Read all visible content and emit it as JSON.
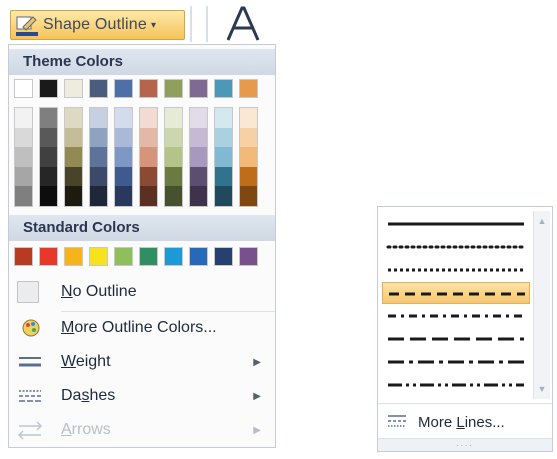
{
  "ribbon": {
    "shape_outline_label": "Shape Outline",
    "dropdown_arrow": "▾",
    "text_icon_char": "A"
  },
  "menu": {
    "theme_colors_label": "Theme Colors",
    "standard_colors_label": "Standard Colors",
    "theme_base": [
      "#ffffff",
      "#1a1a1a",
      "#eeece1",
      "#4a5d7e",
      "#4f6fa8",
      "#b5654b",
      "#8fa05c",
      "#7e6a92",
      "#4b98b8",
      "#e89a4a"
    ],
    "theme_shades": [
      [
        "#f2f2f2",
        "#d9d9d9",
        "#bfbfbf",
        "#a6a6a6",
        "#7f7f7f"
      ],
      [
        "#7f7f7f",
        "#595959",
        "#404040",
        "#262626",
        "#0d0d0d"
      ],
      [
        "#ddd9c3",
        "#c4bd97",
        "#938953",
        "#494429",
        "#1d1b10"
      ],
      [
        "#c6d0e0",
        "#8fa2c2",
        "#5d7399",
        "#3a4a68",
        "#1f2838"
      ],
      [
        "#d3dcec",
        "#a8bad8",
        "#7e97c4",
        "#3e5a8e",
        "#29395e"
      ],
      [
        "#f1dbd2",
        "#e4b8a6",
        "#d6957a",
        "#8b4a34",
        "#5b3023"
      ],
      [
        "#e6ebd7",
        "#ccd7b0",
        "#b3c38a",
        "#6b7943",
        "#48512d"
      ],
      [
        "#e2dcea",
        "#c5b9d4",
        "#a897be",
        "#5d4d70",
        "#3e334a"
      ],
      [
        "#d5e8f0",
        "#abd1e1",
        "#81b9d2",
        "#31728d",
        "#20495c"
      ],
      [
        "#fbe8d2",
        "#f7d1a5",
        "#f2ba78",
        "#c06d1a",
        "#7f4811"
      ]
    ],
    "standard": [
      "#b83a22",
      "#e8382a",
      "#f5b41a",
      "#f7e21c",
      "#8fbf5a",
      "#2f8f63",
      "#1b9ad6",
      "#2569b8",
      "#28406e",
      "#77508c"
    ],
    "items": [
      {
        "label": "No Outline",
        "accel": "N",
        "rest": "o Outline"
      },
      {
        "label": "More Outline Colors...",
        "accel": "M",
        "rest": "ore Outline Colors..."
      },
      {
        "label": "Weight",
        "accel": "W",
        "rest": "eight"
      },
      {
        "label": "Dashes",
        "accel": "s",
        "pre": "Da",
        "rest": "hes"
      },
      {
        "label": "Arrows",
        "accel": "A",
        "rest": "rrows"
      }
    ],
    "submenu_arrow": "▶"
  },
  "dash_panel": {
    "more_lines_label": "More Lines...",
    "more_lines_pre": "More ",
    "more_lines_accel": "L",
    "more_lines_rest": "ines...",
    "selected_index": 3,
    "scroll_up": "▲",
    "scroll_down": "▼",
    "grip": "....",
    "styles": [
      "solid",
      "round-dot",
      "square-dot",
      "dash",
      "dash-dot",
      "long-dash",
      "long-dash-dot",
      "long-dash-dot-dot"
    ]
  }
}
